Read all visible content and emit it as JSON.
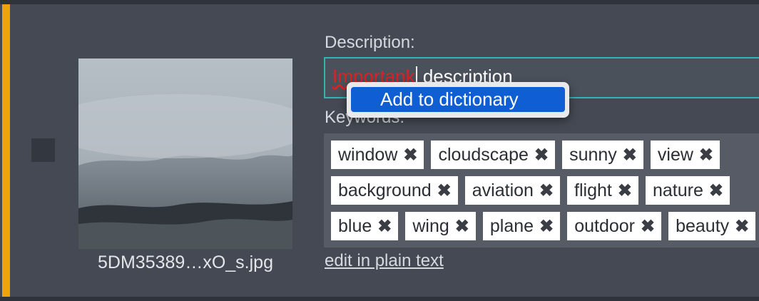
{
  "item": {
    "filename": "5DM35389…xO_s.jpg",
    "description_label": "Description:",
    "description_misspelled": "Importank",
    "description_rest": " description",
    "spell_menu_item": "Add to dictionary",
    "keywords_label": "Keywords:",
    "keywords_rows": [
      [
        "window",
        "cloudscape",
        "sunny",
        "view"
      ],
      [
        "background",
        "aviation",
        "flight",
        "nature"
      ],
      [
        "blue",
        "wing",
        "plane",
        "outdoor",
        "beauty"
      ]
    ],
    "remove_glyph": "✖",
    "edit_link": "edit in plain text"
  },
  "colors": {
    "accent": "#f0a20a",
    "input_border": "#2fb6b0",
    "menu_highlight": "#0f5ed3",
    "misspelled": "#e02020"
  },
  "icons": {
    "remove": "close-icon",
    "selection": "checkbox"
  }
}
